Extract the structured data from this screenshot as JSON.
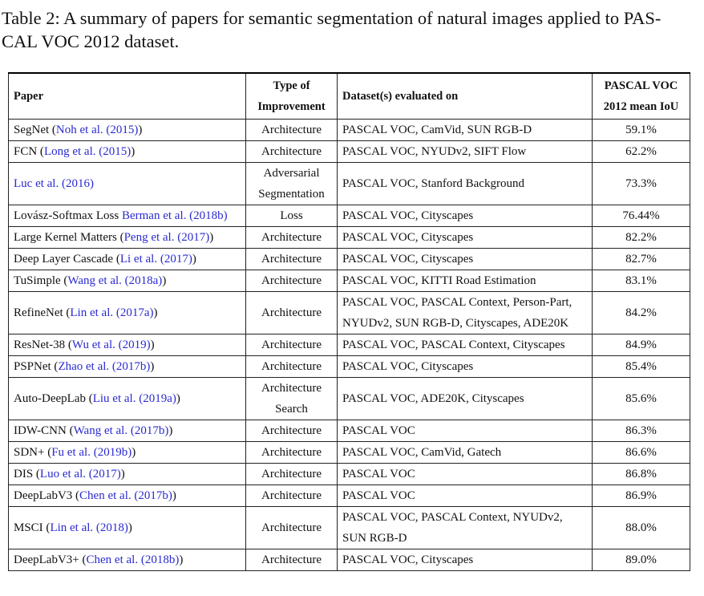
{
  "caption": "Table 2: A summary of papers for semantic segmentation of natural images applied to PAS-CAL VOC 2012 dataset.",
  "caption_line1": "Table 2: A summary of papers for semantic segmentation of natural images applied to PAS-",
  "caption_line2": "CAL VOC 2012 dataset.",
  "headers": {
    "paper": "Paper",
    "type_line1": "Type of",
    "type_line2": "Improvement",
    "dataset": "Dataset(s) evaluated on",
    "iou_line1": "PASCAL VOC",
    "iou_line2": "2012 mean IoU"
  },
  "rows": [
    {
      "name": "SegNet (",
      "cite": "Noh et al. (2015)",
      "tail": ")",
      "type": "Architecture",
      "type2": "",
      "dataset": "PASCAL VOC, CamVid, SUN RGB-D",
      "dataset2": "",
      "iou": "59.1%"
    },
    {
      "name": "FCN (",
      "cite": "Long et al. (2015)",
      "tail": ")",
      "type": "Architecture",
      "type2": "",
      "dataset": "PASCAL VOC, NYUDv2, SIFT Flow",
      "dataset2": "",
      "iou": "62.2%"
    },
    {
      "name": "",
      "cite": "Luc et al. (2016)",
      "tail": "",
      "type": "Adversarial",
      "type2": "Segmentation",
      "dataset": "PASCAL VOC, Stanford Background",
      "dataset2": "",
      "iou": "73.3%"
    },
    {
      "name": "Lovász-Softmax Loss ",
      "cite": "Berman et al. (2018b)",
      "tail": "",
      "type": "Loss",
      "type2": "",
      "dataset": "PASCAL VOC, Cityscapes",
      "dataset2": "",
      "iou": "76.44%"
    },
    {
      "name": "Large Kernel Matters (",
      "cite": "Peng et al. (2017)",
      "tail": ")",
      "type": "Architecture",
      "type2": "",
      "dataset": "PASCAL VOC, Cityscapes",
      "dataset2": "",
      "iou": "82.2%"
    },
    {
      "name": "Deep Layer Cascade (",
      "cite": "Li et al. (2017)",
      "tail": ")",
      "type": "Architecture",
      "type2": "",
      "dataset": "PASCAL VOC, Cityscapes",
      "dataset2": "",
      "iou": "82.7%"
    },
    {
      "name": "TuSimple (",
      "cite": "Wang et al. (2018a)",
      "tail": ")",
      "type": "Architecture",
      "type2": "",
      "dataset": "PASCAL VOC, KITTI Road Estimation",
      "dataset2": "",
      "iou": "83.1%"
    },
    {
      "name": "RefineNet (",
      "cite": "Lin et al. (2017a)",
      "tail": ")",
      "type": "Architecture",
      "type2": "",
      "dataset": "PASCAL VOC, PASCAL Context, Person-Part,",
      "dataset2": "NYUDv2, SUN RGB-D, Cityscapes, ADE20K",
      "iou": "84.2%"
    },
    {
      "name": "ResNet-38 (",
      "cite": "Wu et al. (2019)",
      "tail": ")",
      "type": "Architecture",
      "type2": "",
      "dataset": "PASCAL VOC, PASCAL Context, Cityscapes",
      "dataset2": "",
      "iou": "84.9%"
    },
    {
      "name": "PSPNet (",
      "cite": "Zhao et al. (2017b)",
      "tail": ")",
      "type": "Architecture",
      "type2": "",
      "dataset": "PASCAL VOC, Cityscapes",
      "dataset2": "",
      "iou": "85.4%"
    },
    {
      "name": "Auto-DeepLab (",
      "cite": "Liu et al. (2019a)",
      "tail": ")",
      "type": "Architecture",
      "type2": "Search",
      "dataset": "PASCAL VOC, ADE20K, Cityscapes",
      "dataset2": "",
      "iou": "85.6%"
    },
    {
      "name": "IDW-CNN (",
      "cite": "Wang et al. (2017b)",
      "tail": ")",
      "type": "Architecture",
      "type2": "",
      "dataset": "PASCAL VOC",
      "dataset2": "",
      "iou": "86.3%"
    },
    {
      "name": "SDN+ (",
      "cite": "Fu et al. (2019b)",
      "tail": ")",
      "type": "Architecture",
      "type2": "",
      "dataset": "PASCAL VOC, CamVid, Gatech",
      "dataset2": "",
      "iou": "86.6%"
    },
    {
      "name": "DIS (",
      "cite": "Luo et al. (2017)",
      "tail": ")",
      "type": "Architecture",
      "type2": "",
      "dataset": "PASCAL VOC",
      "dataset2": "",
      "iou": "86.8%"
    },
    {
      "name": "DeepLabV3 (",
      "cite": "Chen et al. (2017b)",
      "tail": ")",
      "type": "Architecture",
      "type2": "",
      "dataset": "PASCAL VOC",
      "dataset2": "",
      "iou": "86.9%"
    },
    {
      "name": "MSCI (",
      "cite": "Lin et al. (2018)",
      "tail": ")",
      "type": "Architecture",
      "type2": "",
      "dataset": "PASCAL VOC, PASCAL Context, NYUDv2,",
      "dataset2": "SUN RGB-D",
      "iou": "88.0%"
    },
    {
      "name": "DeepLabV3+ (",
      "cite": "Chen et al. (2018b)",
      "tail": ")",
      "type": "Architecture",
      "type2": "",
      "dataset": "PASCAL VOC, Cityscapes",
      "dataset2": "",
      "iou": "89.0%"
    }
  ],
  "colors": {
    "citation": "#2a2ad0",
    "text": "#111111",
    "rule": "#000000"
  }
}
